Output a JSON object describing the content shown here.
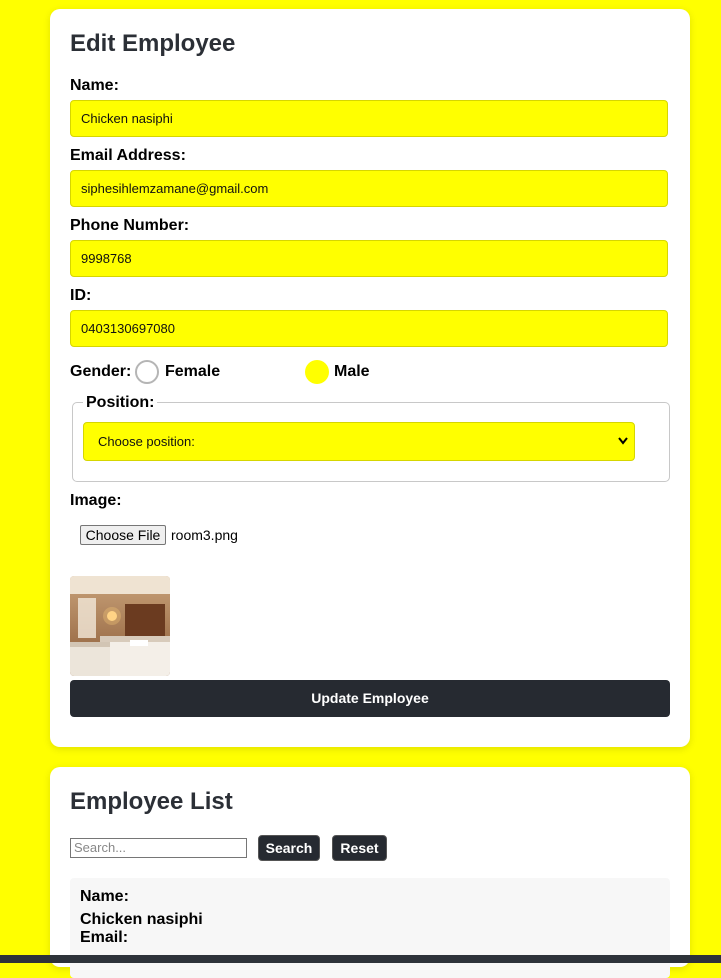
{
  "edit_form": {
    "title": "Edit Employee",
    "name_label": "Name:",
    "name_value": "Chicken nasiphi",
    "email_label": "Email Address:",
    "email_value": "siphesihlemzamane@gmail.com",
    "phone_label": "Phone Number:",
    "phone_value": "9998768",
    "id_label": "ID:",
    "id_value": "0403130697080",
    "gender_label": "Gender:",
    "gender_options": [
      {
        "label": "Female",
        "selected": false
      },
      {
        "label": "Male",
        "selected": true
      }
    ],
    "position_legend": "Position:",
    "position_selected": "Choose position:",
    "image_label": "Image:",
    "file_button": "Choose File",
    "file_name": "room3.png",
    "submit_label": "Update Employee"
  },
  "employee_list": {
    "title": "Employee List",
    "search_placeholder": "Search...",
    "search_button": "Search",
    "reset_button": "Reset",
    "items": [
      {
        "name_label": "Name:",
        "name_value": "Chicken nasiphi",
        "email_label": "Email:"
      }
    ]
  },
  "colors": {
    "page_background": "#ffff00",
    "input_background": "#ffff00",
    "button_dark": "#262a31"
  }
}
